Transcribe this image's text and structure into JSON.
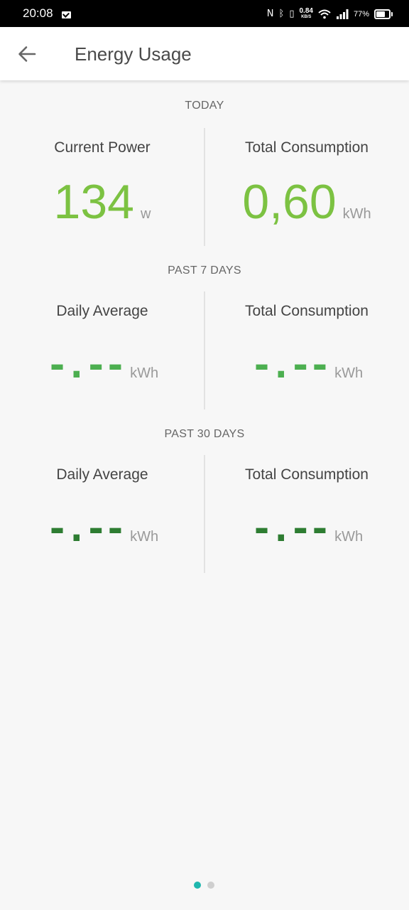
{
  "status_bar": {
    "time": "20:08",
    "network_speed_value": "0.84",
    "network_speed_unit": "KB/S",
    "battery_percent": "77%",
    "battery_level": 0.77
  },
  "app_bar": {
    "title": "Energy Usage"
  },
  "sections": [
    {
      "title": "TODAY",
      "stats": [
        {
          "label": "Current Power",
          "value": "134",
          "unit": "w"
        },
        {
          "label": "Total Consumption",
          "value": "0,60",
          "unit": "kWh"
        }
      ]
    },
    {
      "title": "PAST 7 DAYS",
      "stats": [
        {
          "label": "Daily Average",
          "value": "-.--",
          "unit": "kWh"
        },
        {
          "label": "Total Consumption",
          "value": "-.--",
          "unit": "kWh"
        }
      ]
    },
    {
      "title": "PAST 30 DAYS",
      "stats": [
        {
          "label": "Daily Average",
          "value": "-.--",
          "unit": "kWh"
        },
        {
          "label": "Total Consumption",
          "value": "-.--",
          "unit": "kWh"
        }
      ]
    }
  ],
  "page_indicator": {
    "pages": 2,
    "active_page": 1
  },
  "colors": {
    "value_green": "#7cc242",
    "placeholder_green": "#4caf50",
    "placeholder_dark_green": "#2e7d32",
    "indicator_active": "#1fb7ae"
  }
}
